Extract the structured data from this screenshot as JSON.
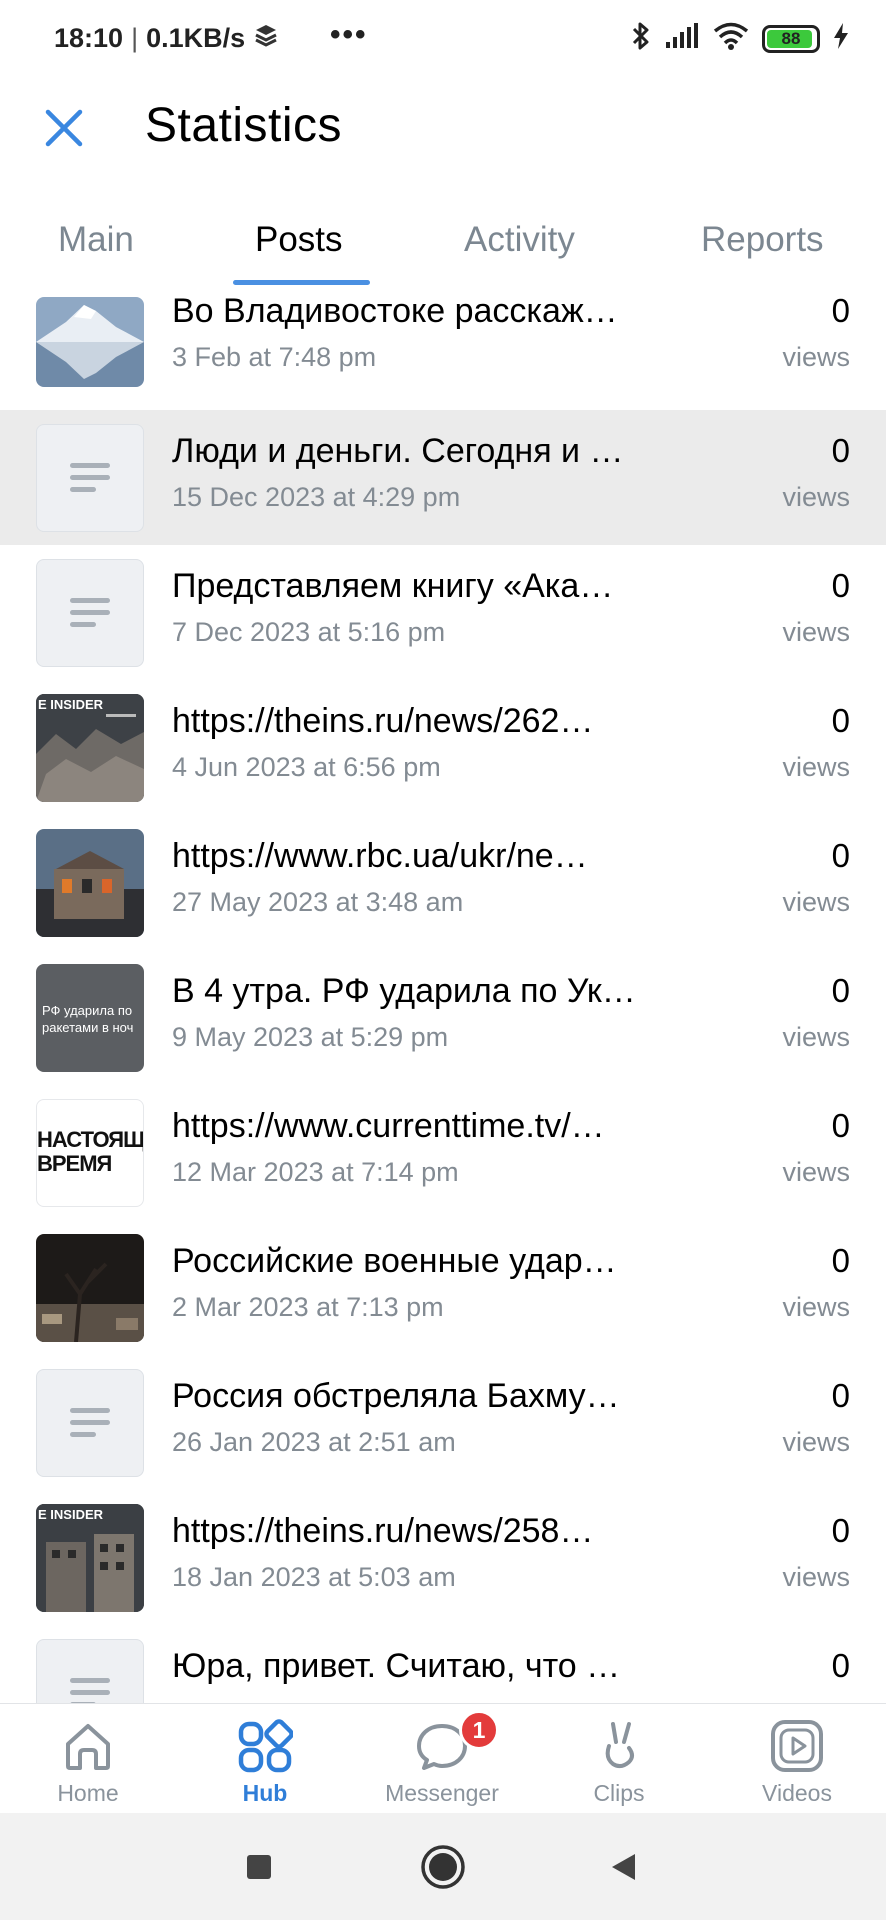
{
  "status_bar": {
    "time": "18:10",
    "separator": "|",
    "net_speed": "0.1KB/s",
    "more": "•••",
    "battery_level": "88"
  },
  "header": {
    "title": "Statistics"
  },
  "tabs": [
    {
      "label": "Main"
    },
    {
      "label": "Posts"
    },
    {
      "label": "Activity"
    },
    {
      "label": "Reports"
    }
  ],
  "posts": [
    {
      "title": "Во Владивостоке расскаж…",
      "date": "3 Feb at 7:48 pm",
      "count": "0",
      "unit": "views",
      "thumb": "mountain"
    },
    {
      "title": "Люди и деньги. Сегодня и …",
      "date": "15 Dec 2023 at 4:29 pm",
      "count": "0",
      "unit": "views",
      "thumb": "placeholder"
    },
    {
      "title": "Представляем книгу «Ака…",
      "date": "7 Dec 2023 at 5:16 pm",
      "count": "0",
      "unit": "views",
      "thumb": "placeholder"
    },
    {
      "title": "https://theins.ru/news/262…",
      "date": "4 Jun 2023 at 6:56 pm",
      "count": "0",
      "unit": "views",
      "thumb": "insider",
      "thumb_text": "E INSIDER"
    },
    {
      "title": "https://www.rbc.ua/ukr/ne…",
      "date": "27 May 2023 at 3:48 am",
      "count": "0",
      "unit": "views",
      "thumb": "fire"
    },
    {
      "title": "В 4 утра. РФ ударила по Ук…",
      "date": "9 May 2023 at 5:29 pm",
      "count": "0",
      "unit": "views",
      "thumb": "text",
      "thumb_text": "РФ ударила по ракетами в ноч"
    },
    {
      "title": "https://www.currenttime.tv/…",
      "date": "12 Mar 2023 at 7:14 pm",
      "count": "0",
      "unit": "views",
      "thumb": "logo",
      "thumb_text": "НАСТОЯЩЕЕ ВРЕМЯ"
    },
    {
      "title": "Российские военные удар…",
      "date": "2 Mar 2023 at 7:13 pm",
      "count": "0",
      "unit": "views",
      "thumb": "night"
    },
    {
      "title": "Россия обстреляла Бахму…",
      "date": "26 Jan 2023 at 2:51 am",
      "count": "0",
      "unit": "views",
      "thumb": "placeholder"
    },
    {
      "title": "https://theins.ru/news/258…",
      "date": "18 Jan 2023 at 5:03 am",
      "count": "0",
      "unit": "views",
      "thumb": "insider",
      "thumb_text": "E INSIDER"
    },
    {
      "title": "Юра, привет. Считаю, что …",
      "date": "",
      "count": "0",
      "unit": "",
      "thumb": "placeholder"
    }
  ],
  "bottom_nav": [
    {
      "label": "Home",
      "icon": "home-icon"
    },
    {
      "label": "Hub",
      "icon": "hub-icon"
    },
    {
      "label": "Messenger",
      "icon": "messenger-icon",
      "badge": "1"
    },
    {
      "label": "Clips",
      "icon": "clips-icon"
    },
    {
      "label": "Videos",
      "icon": "videos-icon"
    }
  ],
  "colors": {
    "accent": "#4a90e2",
    "active_nav": "#2f7ed8",
    "muted": "#838b93",
    "badge": "#e33b3b",
    "highlight_row": "#ebebeb"
  }
}
